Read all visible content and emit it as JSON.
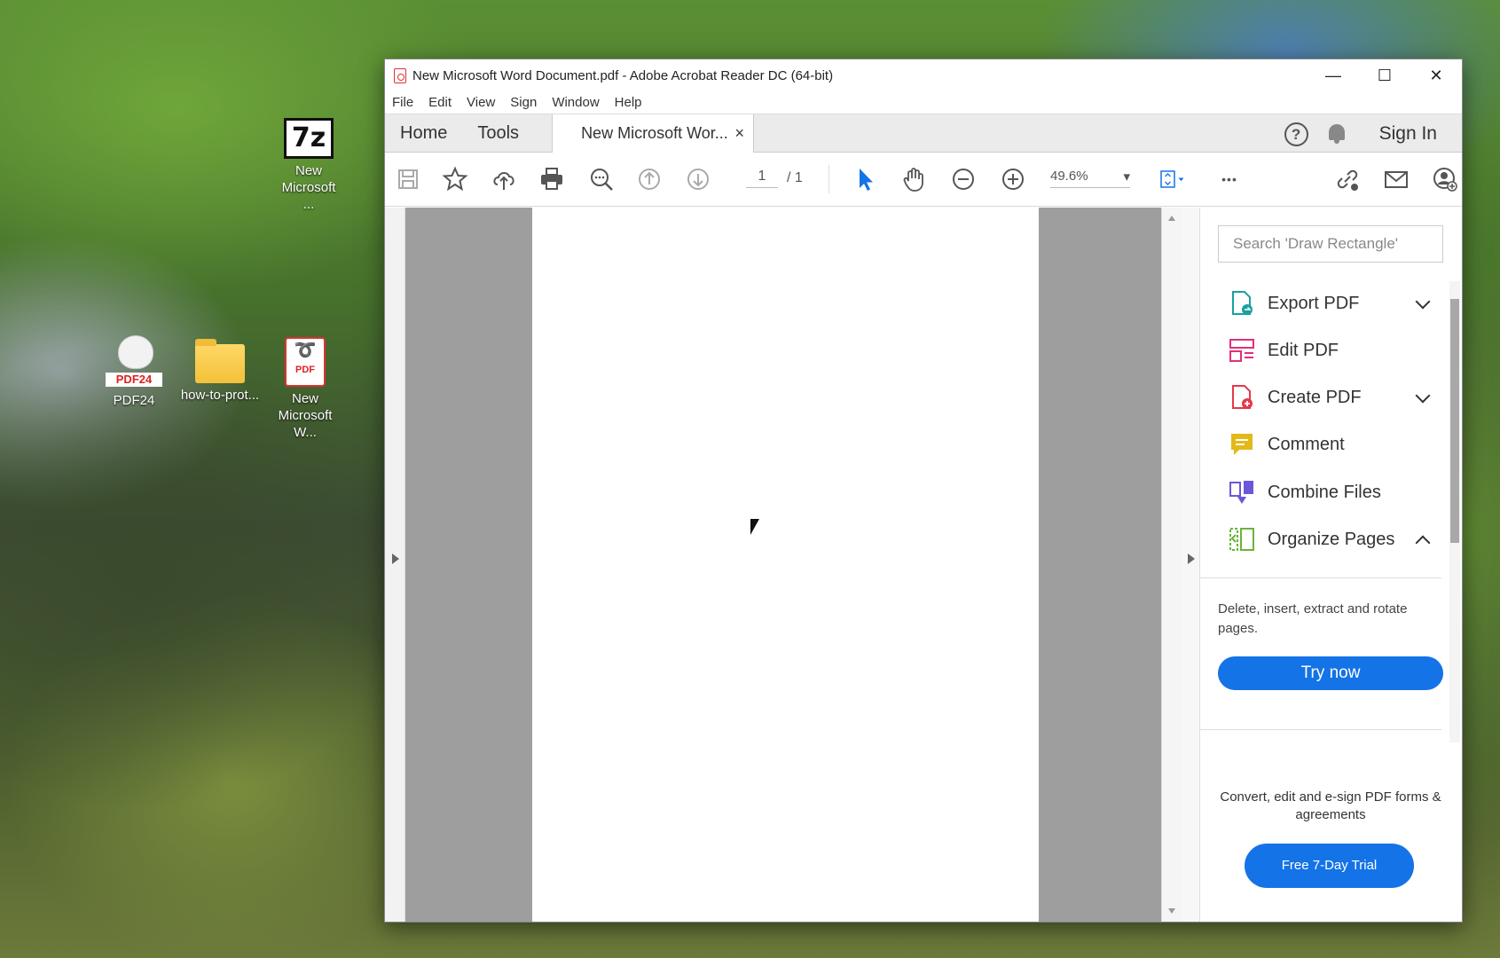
{
  "desktop": {
    "icons": [
      {
        "name": "7z",
        "glyph": "7z",
        "label": "New Microsoft ..."
      },
      {
        "name": "pdf24",
        "glyph": "PDF24",
        "label": "PDF24"
      },
      {
        "name": "folder",
        "label": "how-to-prot..."
      },
      {
        "name": "pdf",
        "glyph": "PDF",
        "label": "New Microsoft W..."
      }
    ]
  },
  "window": {
    "title": "New Microsoft Word Document.pdf - Adobe Acrobat Reader DC (64-bit)",
    "controls": {
      "minimize": "—",
      "maximize": "☐",
      "close": "✕"
    }
  },
  "menu": [
    "File",
    "Edit",
    "View",
    "Sign",
    "Window",
    "Help"
  ],
  "tabs": {
    "home": "Home",
    "tools": "Tools",
    "document": "New Microsoft Wor...",
    "close": "×",
    "help": "?",
    "sign_in": "Sign In"
  },
  "toolbar": {
    "page_current": "1",
    "page_total": "/ 1",
    "zoom": "49.6%",
    "more": "•••",
    "dropdown_arrow": "▾"
  },
  "right_panel": {
    "search_placeholder": "Search 'Draw Rectangle'",
    "tools": [
      {
        "label": "Export PDF",
        "icon": "export-pdf-icon",
        "color": "#19a0a0",
        "expandable": "down"
      },
      {
        "label": "Edit PDF",
        "icon": "edit-pdf-icon",
        "color": "#e0307a",
        "expandable": ""
      },
      {
        "label": "Create PDF",
        "icon": "create-pdf-icon",
        "color": "#e5374b",
        "expandable": "down"
      },
      {
        "label": "Comment",
        "icon": "comment-icon",
        "color": "#e3b91a",
        "expandable": ""
      },
      {
        "label": "Combine Files",
        "icon": "combine-files-icon",
        "color": "#6a58d8",
        "expandable": ""
      },
      {
        "label": "Organize Pages",
        "icon": "organize-pages-icon",
        "color": "#6cb33a",
        "expandable": "up"
      }
    ],
    "description": "Delete, insert, extract and rotate pages.",
    "try_now": "Try now",
    "promo": "Convert, edit and e-sign PDF forms & agreements",
    "trial_button": "Free 7-Day Trial"
  },
  "colors": {
    "accent": "#1473e6",
    "select_tool": "#1473e6"
  }
}
